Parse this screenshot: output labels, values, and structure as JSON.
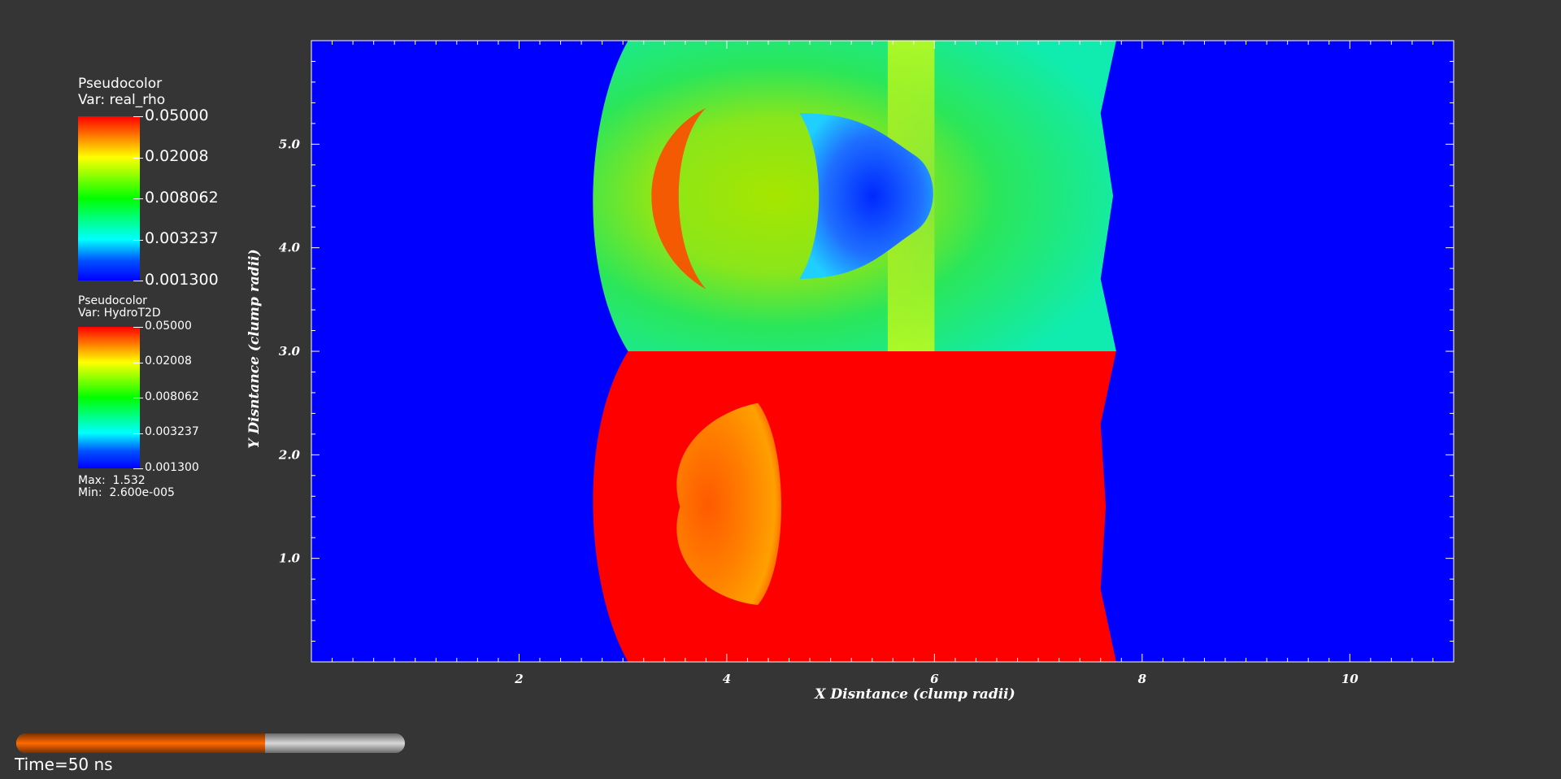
{
  "legend_top": {
    "title": "Pseudocolor",
    "var": "Var: real_rho",
    "ticks": [
      "0.05000",
      "0.02008",
      "0.008062",
      "0.003237",
      "0.001300"
    ]
  },
  "legend_bottom": {
    "title": "Pseudocolor",
    "var": "Var: HydroT2D",
    "ticks": [
      "0.05000",
      "0.02008",
      "0.008062",
      "0.003237",
      "0.001300"
    ],
    "max": "Max:  1.532",
    "min": "Min:  2.600e-005"
  },
  "colors": {
    "background": "#353535",
    "low": "#0000ff",
    "high": "#ff0000",
    "progress_fill": "#ff6a00"
  },
  "time": {
    "label": "Time=50 ns",
    "progress_fraction": 0.64
  },
  "chart_data": {
    "type": "heatmap",
    "xlabel": "X Disntance (clump radii)",
    "ylabel": "Y Disntance (clump radii)",
    "xlim": [
      0,
      11
    ],
    "ylim": [
      0,
      6
    ],
    "x_ticks": [
      2,
      4,
      6,
      8,
      10
    ],
    "x_tick_labels": [
      "2",
      "4",
      "6",
      "8",
      "10"
    ],
    "y_ticks": [
      1,
      2,
      3,
      4,
      5
    ],
    "y_tick_labels": [
      "1.0",
      "2.0",
      "3.0",
      "4.0",
      "5.0"
    ],
    "upper_panel_var": "real_rho",
    "lower_panel_var": "HydroT2D",
    "colorbar_ticks": [
      0.05,
      0.02008,
      0.008062,
      0.003237,
      0.0013
    ],
    "color_scale": "log"
  }
}
